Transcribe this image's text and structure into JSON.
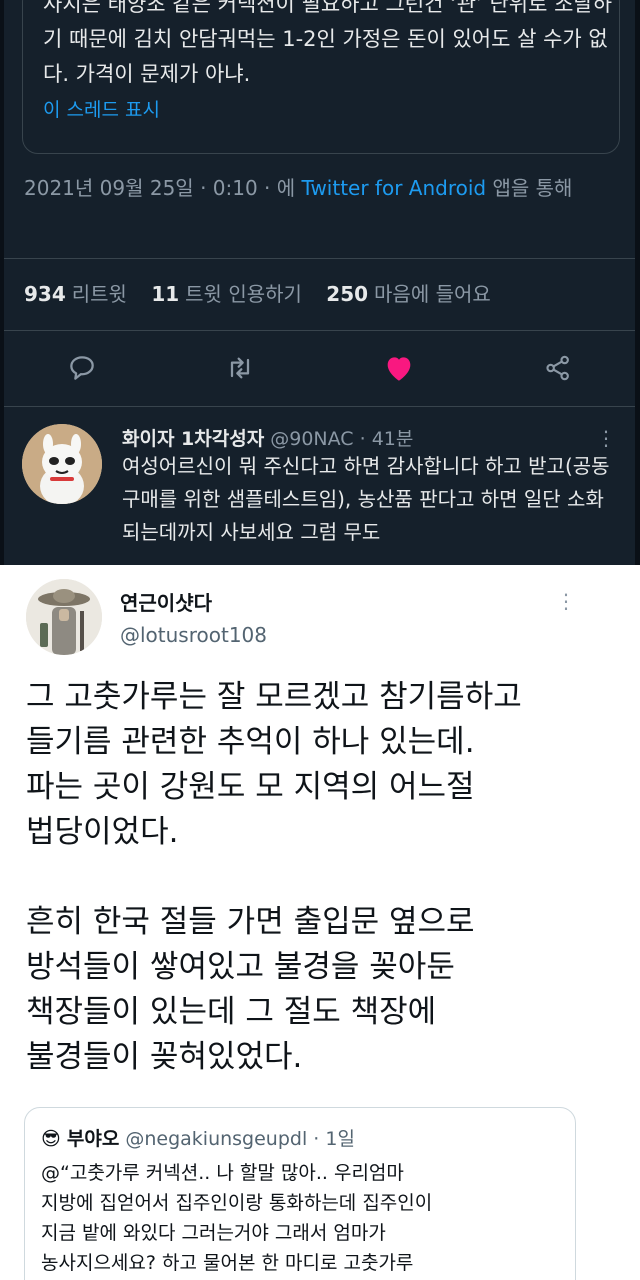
{
  "dark_tweet": {
    "quoted_text": "사지은 태양초 같은 커넥션이 필요하고 그런건 ‘관’ 단위로 조달하기 때문에 김치 안담궈먹는 1-2인 가정은 돈이 있어도 살 수가 없다. 가격이 문제가 아냐.",
    "show_thread_label": "이 스레드 표시",
    "date_text": "2021년 09월 25일 · 0:10 · 에",
    "source_label": "Twitter for Android",
    "via_text": "앱을 통해",
    "stats": {
      "retweets_count": "934",
      "retweets_label": "리트윗",
      "quotes_count": "11",
      "quotes_label": "트윗 인용하기",
      "likes_count": "250",
      "likes_label": "마음에 들어요"
    },
    "actions": [
      "reply-icon",
      "retweet-icon",
      "like-icon",
      "share-icon"
    ],
    "like_color": "#f91880",
    "reply": {
      "name": "화이자 1차각성자",
      "handle": "@90NAC · 41분",
      "text": "여성어르신이 뭐 주신다고 하면 감사합니다 하고 받고(공동구매를 위한 샘플테스트임), 농산품 판다고 하면 일단 소화 되는데까지 사보세요 그럼 무도"
    }
  },
  "light_tweet": {
    "name": "연근이샷다",
    "handle": "@lotusroot108",
    "paragraphs": [
      "그 고춧가루는 잘 모르겠고 참기름하고\n들기름 관련한 추억이 하나 있는데.\n파는 곳이 강원도 모 지역의 어느절\n법당이었다.",
      "흔히 한국 절들 가면 출입문 옆으로\n방석들이 쌓여있고 불경을 꽂아둔\n책장들이 있는데 그 절도 책장에\n불경들이 꽂혀있었다."
    ],
    "quote": {
      "emoji": "😎",
      "name": "부야오",
      "handle": "@negakiunsgeupdl · 1일",
      "text": "@“고춧가루 커넥션.. 나 할말 많아.. 우리엄마\n지방에 집얻어서 집주인이랑 통화하는데 집주인이\n지금 밭에 와있다 그러는거야 그래서 엄마가\n농사지으세요? 하고 물어본 한 마디로 고춧가루"
    }
  },
  "colors": {
    "dark_bg": "#15202b",
    "link_blue": "#1d9bf0",
    "muted_gray": "#8b98a5",
    "light_bg": "#ffffff"
  }
}
